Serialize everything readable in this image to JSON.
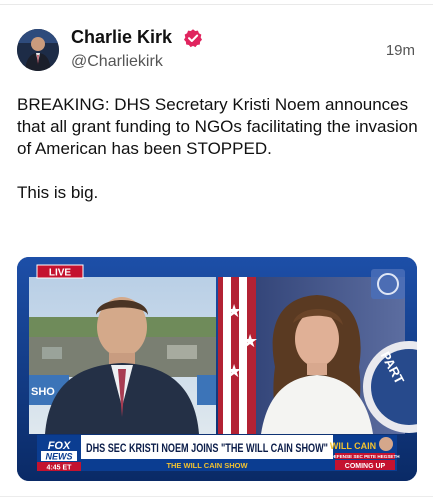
{
  "author": {
    "name": "Charlie Kirk",
    "handle": "@Charliekirk",
    "verified_badge_color": "#e0245e"
  },
  "timestamp": "19m",
  "post": {
    "text_paragraph_1": "BREAKING: DHS Secretary Kristi Noem announces that all grant funding to NGOs facilitating the invasion of American has been STOPPED.",
    "text_paragraph_2": "This is big."
  },
  "media": {
    "live_badge": "LIVE",
    "network_logo_top": "FOX",
    "network_logo_bottom": "NEWS",
    "clock": "4:45 ET",
    "chyron": "DHS SEC KRISTI NOEM JOINS \"THE WILL CAIN SHOW\"",
    "show_strip": "THE WILL CAIN SHOW",
    "promo_title": "WILL CAIN",
    "promo_subtitle": "DEFENSE SEC PETE HEGSETH",
    "promo_coming_up": "COMING UP",
    "wall_text_left": "SHO",
    "seal_text": "PART"
  },
  "icons": {
    "verified": "verified-badge-icon",
    "avatar": "user-avatar"
  }
}
